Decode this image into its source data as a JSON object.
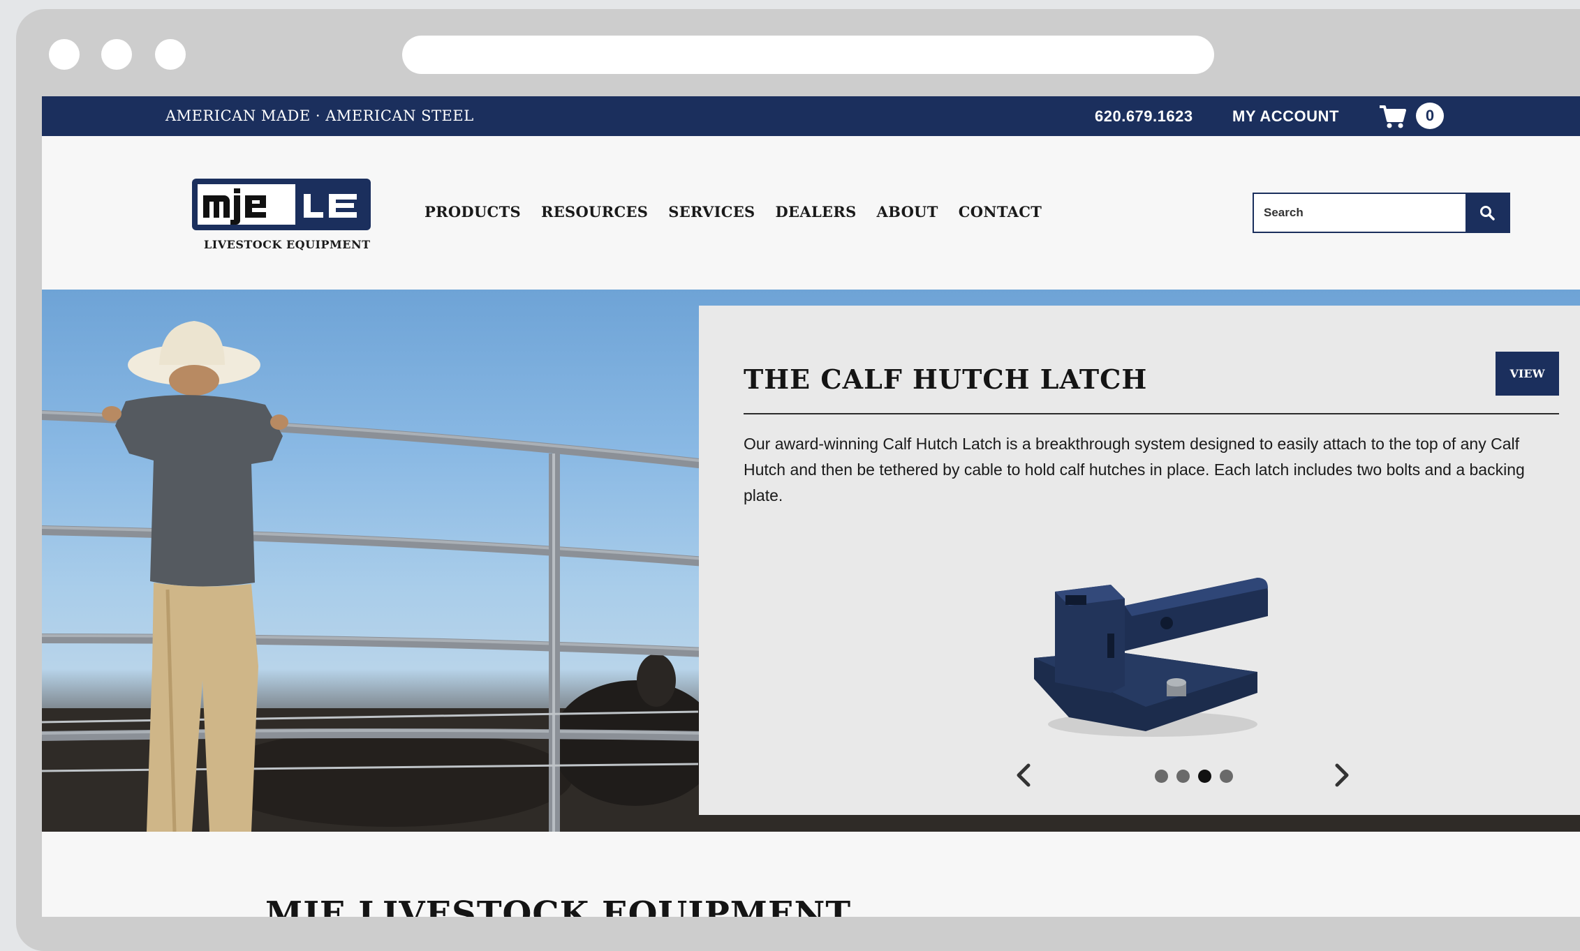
{
  "browser": {
    "window_controls": [
      "close-dot",
      "minimize-dot",
      "maximize-dot"
    ]
  },
  "topbar": {
    "tagline": "AMERICAN MADE · AMERICAN STEEL",
    "phone": "620.679.1623",
    "account": "MY ACCOUNT",
    "cart_count": "0"
  },
  "header": {
    "logo_sub": "LIVESTOCK EQUIPMENT",
    "nav": [
      "PRODUCTS",
      "RESOURCES",
      "SERVICES",
      "DEALERS",
      "ABOUT",
      "CONTACT"
    ],
    "search_placeholder": "Search"
  },
  "hero": {
    "title": "THE CALF HUTCH LATCH",
    "view_label": "VIEW",
    "description": "Our award-winning Calf Hutch Latch is a breakthrough system designed to easily attach to the top of any Calf Hutch and then be tethered by cable to hold calf hutches in place. Each latch includes two bolts and a backing plate.",
    "slide_count": 4,
    "active_slide": 3
  },
  "section": {
    "title": "MJE LIVESTOCK EQUIPMENT"
  },
  "colors": {
    "brand_navy": "#1b2f5d",
    "card_bg": "#e9e9e9"
  }
}
